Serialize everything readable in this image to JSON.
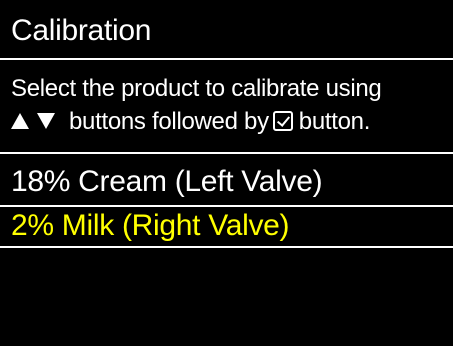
{
  "header": {
    "title": "Calibration"
  },
  "instructions": {
    "line1": "Select the product to calibrate using",
    "line2_after_arrows": "buttons followed by",
    "line2_end": "button.",
    "icons": [
      "up-arrow-icon",
      "down-arrow-icon",
      "checkbox-icon"
    ]
  },
  "products": [
    {
      "label": "18% Cream (Left Valve)",
      "selected": false
    },
    {
      "label": "2% Milk (Right Valve)",
      "selected": true
    }
  ],
  "colors": {
    "background": "#000000",
    "text": "#ffffff",
    "selected": "#ffff00"
  }
}
